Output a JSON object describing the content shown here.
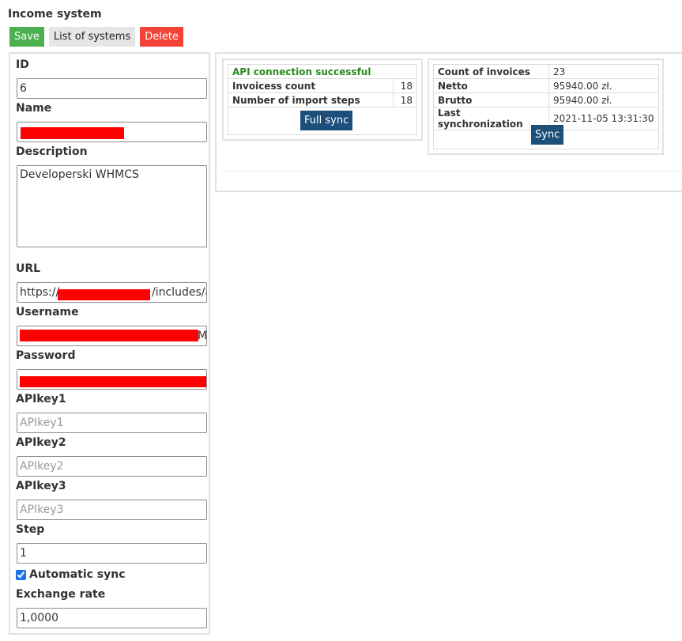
{
  "page": {
    "title": "Income system"
  },
  "toolbar": {
    "save_label": "Save",
    "list_label": "List of systems",
    "delete_label": "Delete"
  },
  "colors": {
    "save": "#4caf50",
    "delete": "#f44336",
    "action": "#1d4f7b",
    "success": "#2a8a1e",
    "redaction": "#ff0000"
  },
  "form": {
    "id": {
      "label": "ID",
      "value": "6"
    },
    "name": {
      "label": "Name",
      "value": ""
    },
    "description": {
      "label": "Description",
      "value": "Developerski WHMCS"
    },
    "url": {
      "label": "URL",
      "value_start": "https://",
      "value_end": "/includes/a"
    },
    "username": {
      "label": "Username",
      "value_tail": "M"
    },
    "password": {
      "label": "Password"
    },
    "apikey1": {
      "label": "APIkey1",
      "placeholder": "APIkey1"
    },
    "apikey2": {
      "label": "APIkey2",
      "placeholder": "APIkey2"
    },
    "apikey3": {
      "label": "APIkey3",
      "placeholder": "APIkey3"
    },
    "step": {
      "label": "Step",
      "value": "1"
    },
    "automatic_sync": {
      "label": "Automatic sync",
      "checked": true
    },
    "exchange_rate": {
      "label": "Exchange rate",
      "value": "1,0000"
    }
  },
  "api_card": {
    "status": "API connection successful",
    "rows": [
      {
        "label": "Invoicess count",
        "value": "18"
      },
      {
        "label": "Number of import steps",
        "value": "18"
      }
    ],
    "button_label": "Full sync"
  },
  "stats_card": {
    "rows": [
      {
        "label": "Count of invoices",
        "value": "23"
      },
      {
        "label": "Netto",
        "value": "95940.00 zł."
      },
      {
        "label": "Brutto",
        "value": "95940.00 zł."
      },
      {
        "label": "Last synchronization",
        "value": "2021-11-05 13:31:30"
      }
    ],
    "button_label": "Sync"
  }
}
